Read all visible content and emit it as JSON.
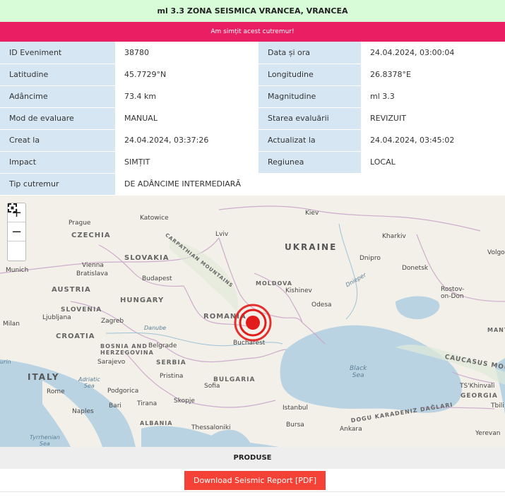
{
  "header": {
    "title": "ml 3.3 ZONA SEISMICA VRANCEA, VRANCEA"
  },
  "felt_button": {
    "label": "Am simțit acest cutremur!"
  },
  "details": {
    "event_id_label": "ID Eveniment",
    "event_id": "38780",
    "datetime_label": "Data și ora",
    "datetime": "24.04.2024, 03:00:04",
    "latitude_label": "Latitudine",
    "latitude": "45.7729°N",
    "longitude_label": "Longitudine",
    "longitude": "26.8378°E",
    "depth_label": "Adâncime",
    "depth": "73.4 km",
    "magnitude_label": "Magnitudine",
    "magnitude": "ml 3.3",
    "eval_mode_label": "Mod de evaluare",
    "eval_mode": "MANUAL",
    "eval_state_label": "Starea evaluării",
    "eval_state": "REVIZUIT",
    "created_label": "Creat la",
    "created": "24.04.2024, 03:37:26",
    "updated_label": "Actualizat la",
    "updated": "24.04.2024, 03:45:02",
    "impact_label": "Impact",
    "impact": "SIMȚIT",
    "region_label": "Regiunea",
    "region": "LOCAL",
    "type_label": "Tip cutremur",
    "type": "DE ADÂNCIME INTERMEDIARĂ"
  },
  "map": {
    "zoom_in": "+",
    "zoom_out": "−",
    "fullscreen_icon": "fullscreen-icon",
    "epicenter_color": "#e21b1b",
    "labels": {
      "kiev": "Kiev",
      "kharkiv": "Kharkiv",
      "lviv": "Lviv",
      "katowice": "Katowice",
      "prague": "Prague",
      "czechia": "CZECHIA",
      "slovakia": "SLOVAKIA",
      "ukraine": "UKRAINE",
      "dnipro": "Dnipro",
      "donetsk": "Donetsk",
      "volgo": "Volgo",
      "rostov": "Rostov-\non-Don",
      "munich": "Munich",
      "vienna": "Vienna",
      "bratislava": "Bratislava",
      "budapest": "Budapest",
      "austria": "AUSTRIA",
      "hungary": "HUNGARY",
      "moldova": "MOLDOVA",
      "kishinev": "Kishinev",
      "odesa": "Odesa",
      "romania": "ROMANIA",
      "slovenia": "SLOVENIA",
      "ljubljana": "Ljubljana",
      "zagreb": "Zagreb",
      "milan": "Milan",
      "croatia": "CROATIA",
      "bosnia": "BOSNIA AND\nHERZEGOVINA",
      "belgrade": "Belgrade",
      "sarajevo": "Sarajevo",
      "serbia": "SERBIA",
      "bucharest": "Bucharest",
      "italy": "ITALY",
      "pristina": "Pristina",
      "sofia": "Sofia",
      "bulgaria": "BULGARIA",
      "rome": "Rome",
      "podgorica": "Podgorica",
      "skopje": "Skopje",
      "naples": "Naples",
      "bari": "Bari",
      "tirana": "Tirana",
      "albania": "ALBANIA",
      "thessaloniki": "Thessaloniki",
      "istanbul": "Istanbul",
      "bursa": "Bursa",
      "ankara": "Ankara",
      "black_sea": "Black\nSea",
      "adriatic": "Adriatic\nSea",
      "tyrrhenian": "Tyrrhenian\nSea",
      "caucasus": "CAUCASUS MOU",
      "tskhinvali": "TS'Khinvali",
      "georgia": "GEORGIA",
      "tbilisi": "Tbili",
      "yerevan": "Yerevan",
      "dogu": "DOGU KARADENIZ DAĞLARI",
      "carpathian": "CARPATHIAN MOUNTAINS",
      "dnieper": "Dnieper",
      "danube": "Danube",
      "manyt": "MANT",
      "urin": "urin"
    }
  },
  "products": {
    "title": "PRODUSE",
    "download_label": "Download Seismic Report [PDF]"
  }
}
